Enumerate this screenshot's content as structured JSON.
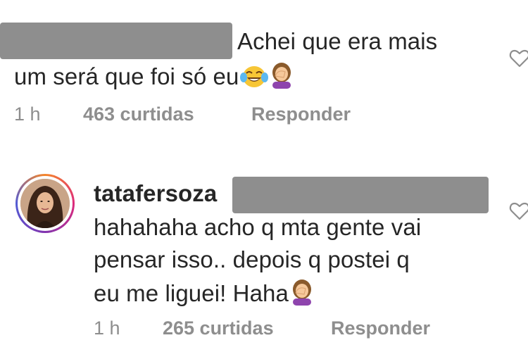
{
  "comment1": {
    "text_line1": "Achei que era mais",
    "text_line2": "um será que foi só eu",
    "emojis": [
      "face-with-tears-of-joy",
      "person-facepalming"
    ],
    "time": "1 h",
    "likes": "463 curtidas",
    "reply": "Responder"
  },
  "comment2": {
    "username": "tatafersoza",
    "text_line1": "hahahaha acho q mta gente vai",
    "text_line2": "pensar isso.. depois q postei q",
    "text_line3": "eu me liguei! Haha",
    "emojis": [
      "person-facepalming"
    ],
    "time": "1 h",
    "likes": "265 curtidas",
    "reply": "Responder"
  },
  "icons": {
    "like": "heart-outline-icon"
  },
  "colors": {
    "text": "#262626",
    "meta": "#8e8e8e",
    "redaction": "#8e8e8e"
  }
}
